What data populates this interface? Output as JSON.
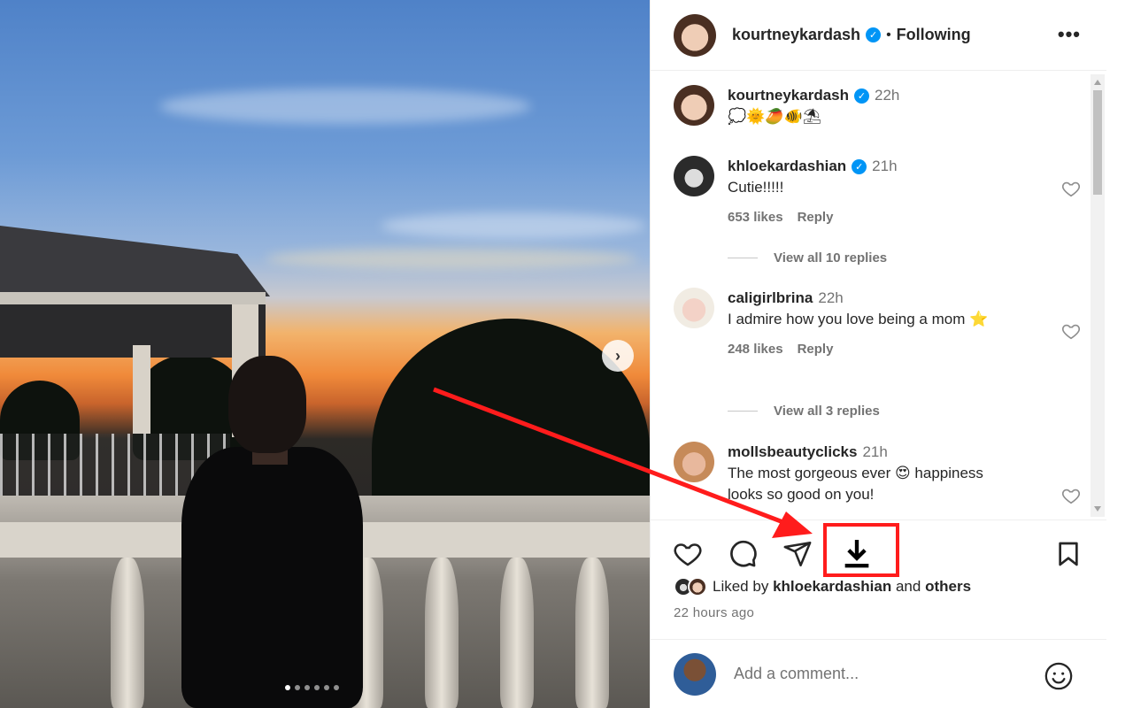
{
  "post": {
    "username": "kourtneykardash",
    "follow_status": "Following",
    "separator": "•",
    "more_label": "•••"
  },
  "caption": {
    "username": "kourtneykardash",
    "time": "22h",
    "text": "💭🌞🥭🐠⛱"
  },
  "comments": [
    {
      "username": "khloekardashian",
      "time": "21h",
      "text": "Cutie!!!!!",
      "likes": "653 likes",
      "reply": "Reply",
      "view_replies": "View all 10 replies"
    },
    {
      "username": "caligirlbrina",
      "time": "22h",
      "text": "I admire how you love being a mom ⭐",
      "likes": "248 likes",
      "reply": "Reply",
      "view_replies": "View all 3 replies"
    },
    {
      "username": "mollsbeautyclicks",
      "time": "21h",
      "text": "The most gorgeous ever 😍 happiness looks so good on you!"
    }
  ],
  "actions": {
    "like_icon": "heart-icon",
    "comment_icon": "comment-icon",
    "share_icon": "paper-plane-icon",
    "download_icon": "download-icon",
    "save_icon": "bookmark-icon"
  },
  "likes_line": {
    "prefix": "Liked by",
    "user": "khloekardashian",
    "connector": "and",
    "suffix": "others"
  },
  "posted_ago": "22 hours ago",
  "add_comment": {
    "placeholder": "Add a comment..."
  },
  "carousel": {
    "total": 6,
    "active": 0,
    "next_label": "›"
  },
  "colors": {
    "accent": "#0095f6",
    "highlight": "#ff1c1c",
    "arrow": "#ff1c1c"
  }
}
